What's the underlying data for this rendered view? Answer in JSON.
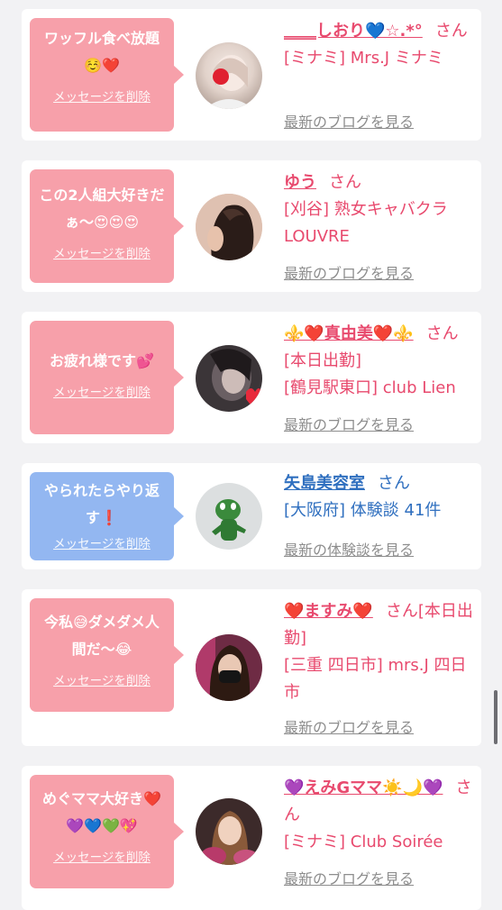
{
  "entries": [
    {
      "message": "ワッフル食べ放題☺️❤️",
      "delete_label": "メッセージを削除",
      "name": "‗‗‗‗しおり💙☆.*°",
      "san": "さん",
      "detail": "[ミナミ] Mrs.J ミナミ",
      "link": "最新のブログを見る",
      "bubble_color": "#f7a0aa"
    },
    {
      "message": "この2人組大好きだぁ〜😍😍😍",
      "delete_label": "メッセージを削除",
      "name": "ゆう",
      "san": "さん",
      "detail": "[刈谷] 熟女キャバクラ LOUVRE",
      "link": "最新のブログを見る",
      "bubble_color": "#f7a0aa"
    },
    {
      "message": "お疲れ様です💕",
      "delete_label": "メッセージを削除",
      "name": "⚜️❤️真由美❤️⚜️",
      "san": "さん[本日出勤]",
      "detail": "[鶴見駅東口] club Lien",
      "link": "最新のブログを見る",
      "bubble_color": "#f7a0aa"
    },
    {
      "message": "やられたらやり返す❗️",
      "delete_label": "メッセージを削除",
      "name": "矢島美容室",
      "san": "さん",
      "detail": "[大阪府] 体験談 41件",
      "link": "最新の体験談を見る",
      "bubble_color": "#93b7f1"
    },
    {
      "message": "今私😅ダメダメ人間だ〜😂",
      "delete_label": "メッセージを削除",
      "name": "❤️ますみ❤️",
      "san": "さん[本日出勤]",
      "detail": "[三重 四日市] mrs.J 四日市",
      "link": "最新のブログを見る",
      "bubble_color": "#f7a0aa"
    },
    {
      "message": "めぐママ大好き❤️💜💙💚💖",
      "delete_label": "メッセージを削除",
      "name": "💜えみGママ☀️🌙💜",
      "san": "さん",
      "detail": "[ミナミ] Club Soirée",
      "link": "最新のブログを見る",
      "bubble_color": "#f7a0aa"
    }
  ]
}
